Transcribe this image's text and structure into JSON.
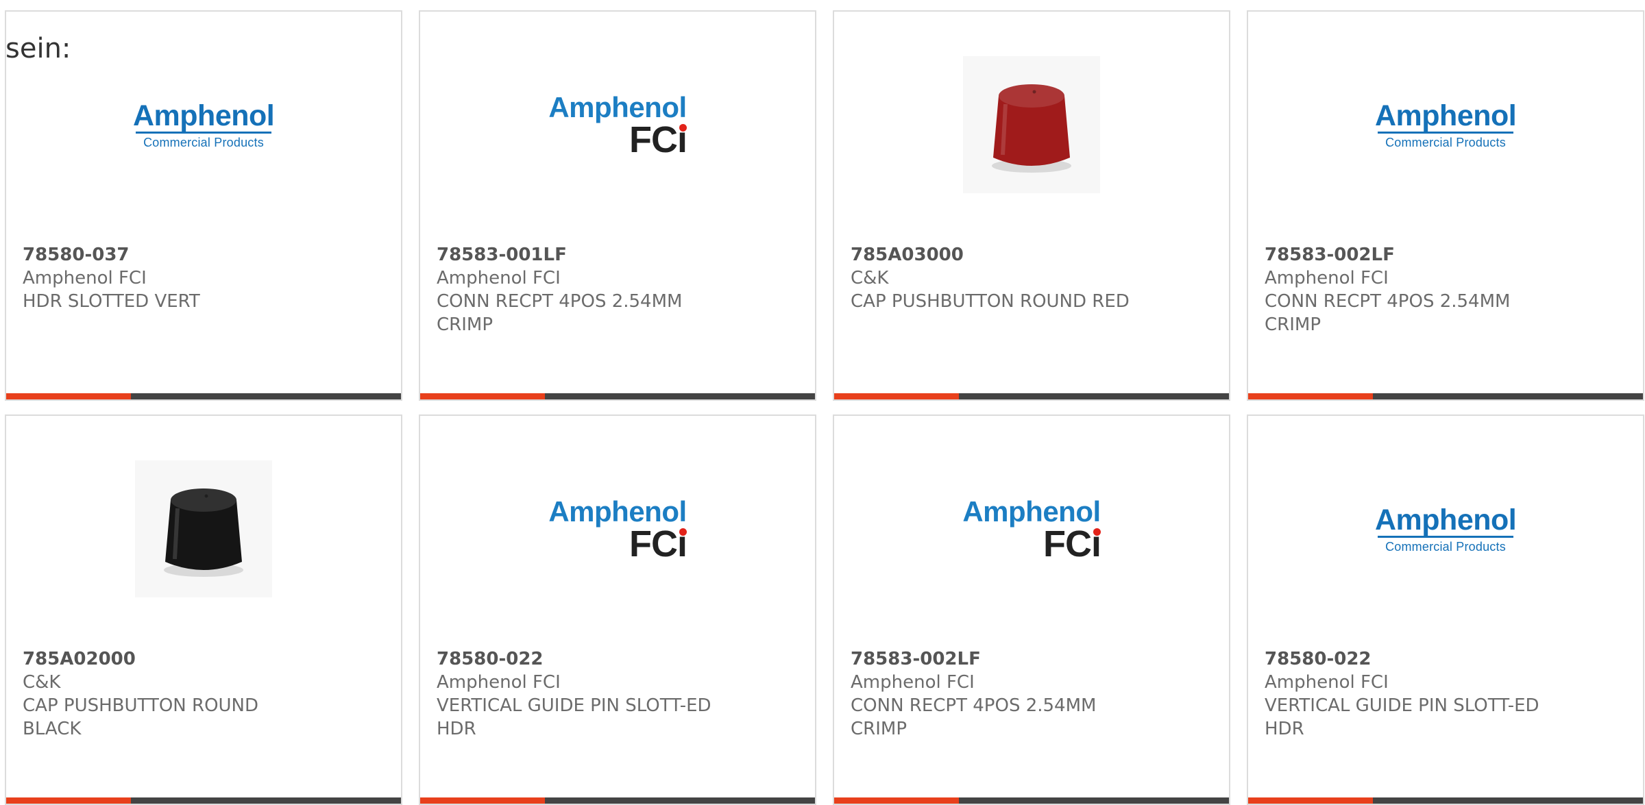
{
  "intro": {
    "text": "sein:"
  },
  "products": [
    {
      "part_number": "78580-037",
      "manufacturer": "Amphenol FCI",
      "description_lines": [
        "HDR SLOTTED VERT"
      ],
      "image": "amphenol-commercial-logo",
      "logo_text": {
        "word": "Amphenol",
        "sub": "Commercial Products"
      }
    },
    {
      "part_number": "78583-001LF",
      "manufacturer": "Amphenol FCI",
      "description_lines": [
        "CONN RECPT 4POS 2.54MM",
        "CRIMP"
      ],
      "image": "amphenol-fci-logo",
      "logo_text": {
        "word": "Amphenol",
        "mark": "FC",
        "mark_tail": "i"
      }
    },
    {
      "part_number": "785A03000",
      "manufacturer": "C&K",
      "description_lines": [
        "CAP PUSHBUTTON ROUND RED"
      ],
      "image": "red-pushbutton-cap",
      "cap_color": "#a01b1b"
    },
    {
      "part_number": "78583-002LF",
      "manufacturer": "Amphenol FCI",
      "description_lines": [
        "CONN RECPT 4POS 2.54MM",
        "CRIMP"
      ],
      "image": "amphenol-commercial-logo",
      "logo_text": {
        "word": "Amphenol",
        "sub": "Commercial Products"
      }
    },
    {
      "part_number": "785A02000",
      "manufacturer": "C&K",
      "description_lines": [
        "CAP PUSHBUTTON ROUND",
        "BLACK"
      ],
      "image": "black-pushbutton-cap",
      "cap_color": "#151515"
    },
    {
      "part_number": "78580-022",
      "manufacturer": "Amphenol FCI",
      "description_lines": [
        "VERTICAL GUIDE PIN SLOTT-ED",
        "HDR"
      ],
      "image": "amphenol-fci-logo",
      "logo_text": {
        "word": "Amphenol",
        "mark": "FC",
        "mark_tail": "i"
      }
    },
    {
      "part_number": "78583-002LF",
      "manufacturer": "Amphenol FCI",
      "description_lines": [
        "CONN RECPT 4POS 2.54MM",
        "CRIMP"
      ],
      "image": "amphenol-fci-logo",
      "logo_text": {
        "word": "Amphenol",
        "mark": "FC",
        "mark_tail": "i"
      }
    },
    {
      "part_number": "78580-022",
      "manufacturer": "Amphenol FCI",
      "description_lines": [
        "VERTICAL GUIDE PIN SLOTT-ED",
        "HDR"
      ],
      "image": "amphenol-commercial-logo",
      "logo_text": {
        "word": "Amphenol",
        "sub": "Commercial Products"
      }
    }
  ],
  "colors": {
    "accent": "#e8401c",
    "bar": "#444444",
    "card_border": "#dcdcdc",
    "text": "#6b6b6b",
    "amphenol_blue": "#1571b8",
    "fci_red_dot": "#e2231a"
  }
}
